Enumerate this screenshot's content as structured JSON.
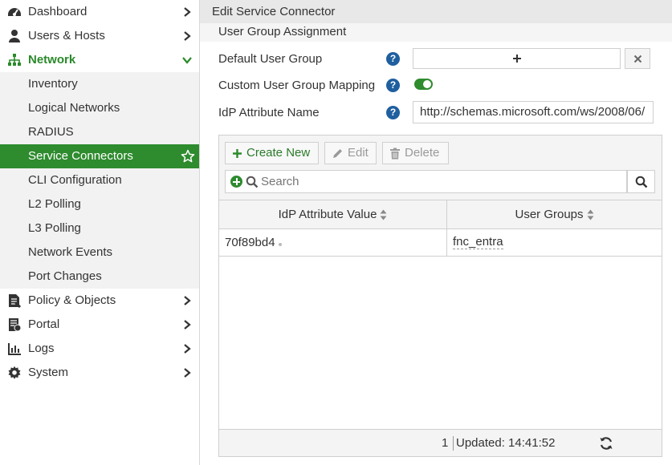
{
  "sidebar": {
    "items": [
      {
        "label": "Dashboard",
        "icon": "dashboard-icon"
      },
      {
        "label": "Users & Hosts",
        "icon": "user-icon"
      },
      {
        "label": "Network",
        "icon": "network-icon",
        "expanded": true
      },
      {
        "label": "Policy & Objects",
        "icon": "policy-icon"
      },
      {
        "label": "Portal",
        "icon": "portal-icon"
      },
      {
        "label": "Logs",
        "icon": "logs-icon"
      },
      {
        "label": "System",
        "icon": "gear-icon"
      }
    ],
    "network_sub": [
      {
        "label": "Inventory"
      },
      {
        "label": "Logical Networks"
      },
      {
        "label": "RADIUS"
      },
      {
        "label": "Service Connectors",
        "selected": true
      },
      {
        "label": "CLI Configuration"
      },
      {
        "label": "L2 Polling"
      },
      {
        "label": "L3 Polling"
      },
      {
        "label": "Network Events"
      },
      {
        "label": "Port Changes"
      }
    ]
  },
  "main": {
    "title": "Edit Service Connector",
    "section": "User Group Assignment",
    "form": {
      "default_user_group_label": "Default User Group",
      "custom_mapping_label": "Custom User Group Mapping",
      "custom_mapping_enabled": true,
      "idp_attribute_label": "IdP Attribute Name",
      "idp_attribute_value": "http://schemas.microsoft.com/ws/2008/06/"
    },
    "toolbar": {
      "create_label": "Create New",
      "edit_label": "Edit",
      "delete_label": "Delete"
    },
    "search": {
      "placeholder": "Search"
    },
    "table": {
      "columns": [
        "IdP Attribute Value",
        "User Groups"
      ],
      "rows": [
        {
          "idp_value": "70f89bd4",
          "user_group": "fnc_entra"
        }
      ]
    },
    "footer": {
      "count": "1",
      "updated": "Updated: 14:41:52"
    }
  },
  "colors": {
    "accent": "#2e8b2e",
    "help": "#1f5f9f"
  }
}
